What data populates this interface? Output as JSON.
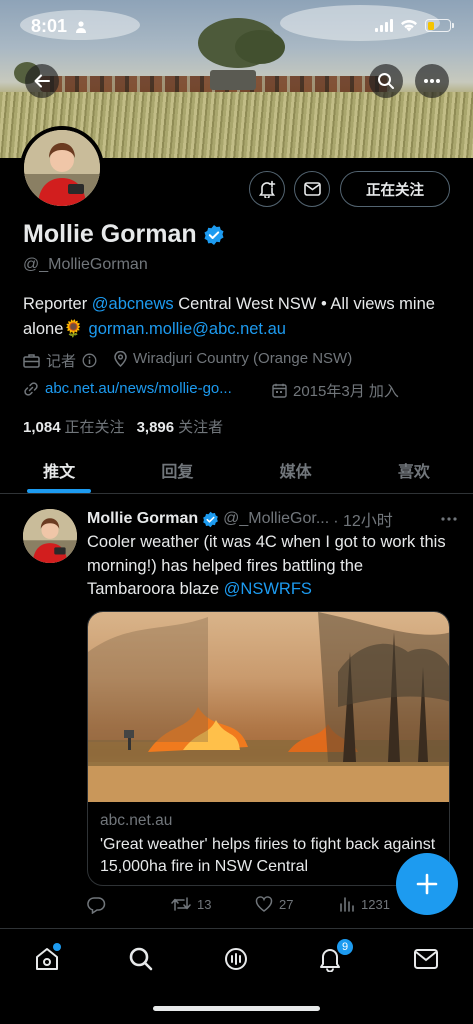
{
  "status_bar": {
    "time": "8:01"
  },
  "profile": {
    "name": "Mollie Gorman",
    "handle": "@_MollieGorman",
    "bio_prefix": "Reporter ",
    "bio_mention": "@abcnews",
    "bio_middle": " Central West NSW • All views mine alone",
    "bio_emoji": "🌻",
    "bio_email": "gorman.mollie@abc.net.au",
    "category": "记者",
    "location": "Wiradjuri Country (Orange NSW)",
    "website": "abc.net.au/news/mollie-go...",
    "joined": "2015年3月 加入",
    "following_count": "1,084",
    "following_label": "正在关注",
    "followers_count": "3,896",
    "followers_label": "关注者",
    "follow_button": "正在关注"
  },
  "tabs": [
    {
      "label": "推文",
      "active": true
    },
    {
      "label": "回复",
      "active": false
    },
    {
      "label": "媒体",
      "active": false
    },
    {
      "label": "喜欢",
      "active": false
    }
  ],
  "tweet": {
    "name": "Mollie Gorman",
    "handle": "@_MollieGor...",
    "time": "· 12小时",
    "text_main": "Cooler weather (it was 4C when I got to work this morning!) has helped fires battling the Tambaroora blaze ",
    "text_mention": "@NSWRFS",
    "card_domain": "abc.net.au",
    "card_title": "'Great weather' helps firies to fight back against 15,000ha fire in NSW Central",
    "retweets": "13",
    "likes": "27",
    "views": "1231"
  },
  "nav": {
    "notifications_badge": "9"
  },
  "colors": {
    "accent": "#1d9bf0",
    "background": "#000000",
    "text": "#e7e9ea",
    "muted": "#71767b"
  }
}
